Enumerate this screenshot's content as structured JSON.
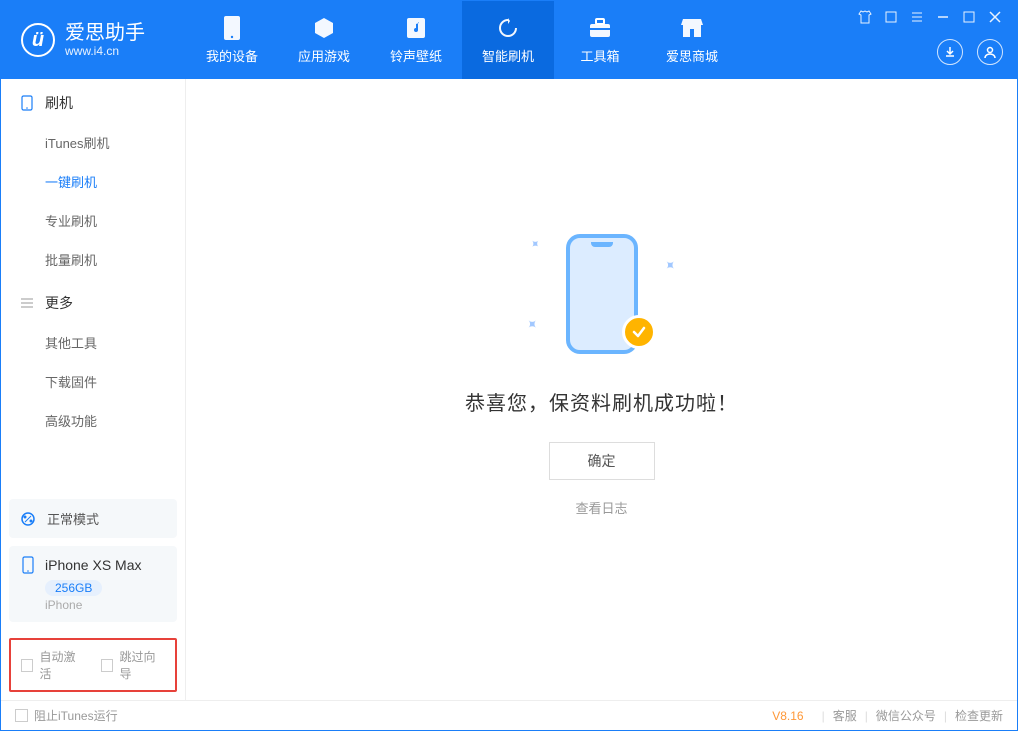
{
  "app": {
    "title": "爱思助手",
    "subtitle": "www.i4.cn"
  },
  "nav": {
    "items": [
      {
        "label": "我的设备",
        "icon": "device"
      },
      {
        "label": "应用游戏",
        "icon": "cube"
      },
      {
        "label": "铃声壁纸",
        "icon": "music"
      },
      {
        "label": "智能刷机",
        "icon": "refresh",
        "active": true
      },
      {
        "label": "工具箱",
        "icon": "toolbox"
      },
      {
        "label": "爱思商城",
        "icon": "store"
      }
    ]
  },
  "sidebar": {
    "section1": {
      "title": "刷机"
    },
    "items1": [
      {
        "label": "iTunes刷机"
      },
      {
        "label": "一键刷机",
        "active": true
      },
      {
        "label": "专业刷机"
      },
      {
        "label": "批量刷机"
      }
    ],
    "section2": {
      "title": "更多"
    },
    "items2": [
      {
        "label": "其他工具"
      },
      {
        "label": "下载固件"
      },
      {
        "label": "高级功能"
      }
    ]
  },
  "device_mode": {
    "label": "正常模式"
  },
  "device": {
    "name": "iPhone XS Max",
    "storage": "256GB",
    "type": "iPhone"
  },
  "options": {
    "auto_activate": "自动激活",
    "skip_guide": "跳过向导"
  },
  "main": {
    "success_text": "恭喜您，保资料刷机成功啦！",
    "ok_button": "确定",
    "log_link": "查看日志"
  },
  "footer": {
    "block_itunes": "阻止iTunes运行",
    "version": "V8.16",
    "links": [
      "客服",
      "微信公众号",
      "检查更新"
    ]
  }
}
